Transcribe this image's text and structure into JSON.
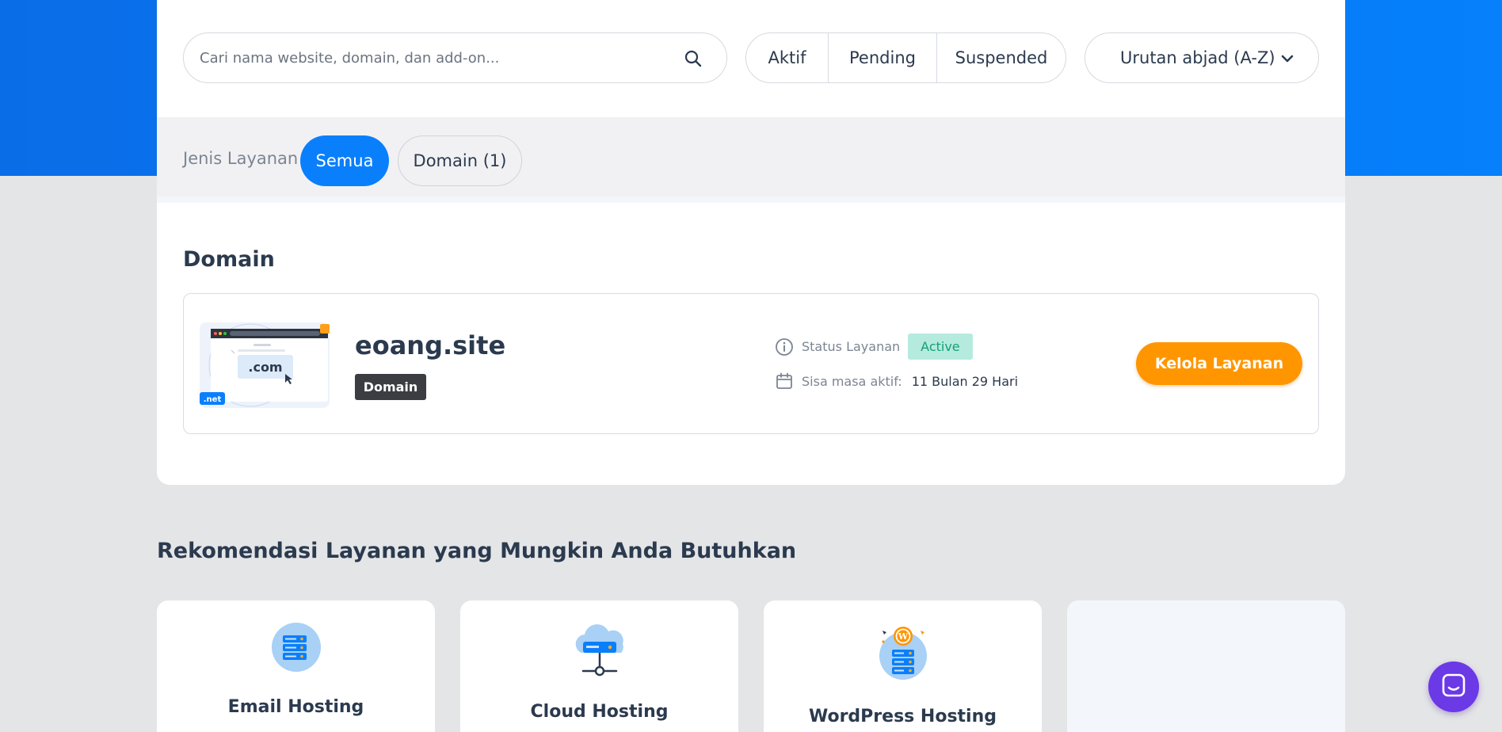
{
  "search": {
    "placeholder": "Cari nama website, domain, dan add-on..."
  },
  "status_filters": [
    "Aktif",
    "Pending",
    "Suspended"
  ],
  "sort": {
    "selected": "Urutan abjad (A-Z)"
  },
  "service_type": {
    "label": "Jenis Layanan",
    "chips": [
      "Semua",
      "Domain (1)"
    ]
  },
  "section": {
    "title": "Domain"
  },
  "service": {
    "thumb_main": ".com",
    "thumb_tag": ".net",
    "name": "eoang.site",
    "type": "Domain",
    "status_label": "Status Layanan",
    "status_value": "Active",
    "remaining_label": "Sisa masa aktif:",
    "remaining_value": "11 Bulan 29 Hari",
    "manage_button": "Kelola Layanan"
  },
  "recommendations": {
    "title": "Rekomendasi Layanan yang Mungkin Anda Butuhkan",
    "items": [
      {
        "name": "Email Hosting",
        "icon": "email-hosting-icon"
      },
      {
        "name": "Cloud Hosting",
        "icon": "cloud-hosting-icon"
      },
      {
        "name": "WordPress Hosting",
        "icon": "wordpress-hosting-icon"
      }
    ]
  },
  "colors": {
    "primary": "#0a7ffb",
    "accent": "#ff9600",
    "active_bg": "#b5ebdf",
    "active_text": "#15a078",
    "chat": "#6b39e6"
  }
}
